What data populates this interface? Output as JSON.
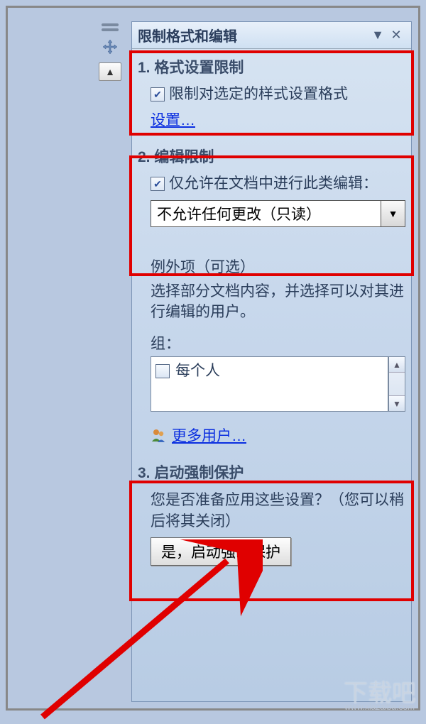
{
  "panel": {
    "title": "限制格式和编辑"
  },
  "section1": {
    "heading": "1. 格式设置限制",
    "checkbox_label": "限制对选定的样式设置格式",
    "settings_link": "设置…"
  },
  "section2": {
    "heading": "2. 编辑限制",
    "checkbox_label": "仅允许在文档中进行此类编辑：",
    "dropdown_value": "不允许任何更改（只读）",
    "exceptions_title": "例外项（可选）",
    "exceptions_desc": "选择部分文档内容，并选择可以对其进行编辑的用户。",
    "group_label": "组：",
    "list_item": "每个人",
    "more_users_link": "更多用户…"
  },
  "section3": {
    "heading": "3. 启动强制保护",
    "prompt": "您是否准备应用这些设置？（您可以稍后将其关闭）",
    "button_label": "是，启动强制保护"
  },
  "watermark": {
    "main": "下载吧",
    "sub": "www.xiazaiba.com"
  }
}
